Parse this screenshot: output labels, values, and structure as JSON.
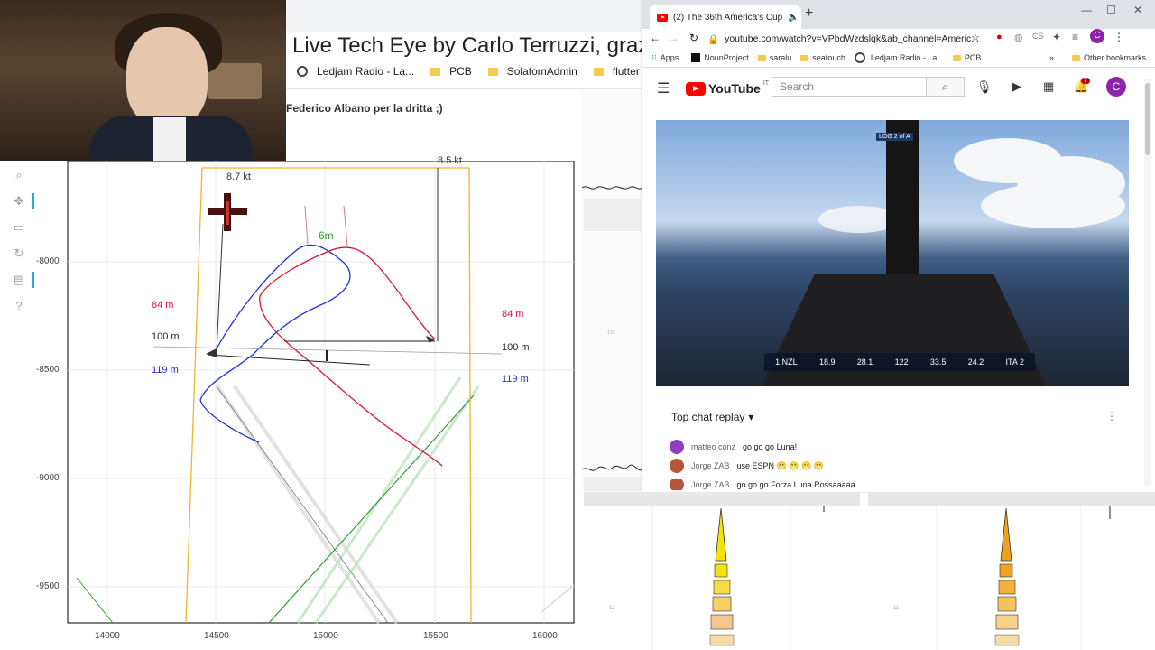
{
  "webcam": {
    "description_icon": "webcam-feed"
  },
  "background_browser": {
    "title": "Live Tech Eye by Carlo Terruzzi, graz",
    "bookmarks": [
      {
        "label": "Ledjam Radio - La..."
      },
      {
        "label": "PCB"
      },
      {
        "label": "SolatomAdmin"
      },
      {
        "label": "flutter"
      }
    ],
    "credit": "Federico Albano per la dritta ;)"
  },
  "plot": {
    "y_ticks": [
      "-8000",
      "-8500",
      "-9000",
      "-9500"
    ],
    "x_ticks": [
      "14000",
      "14500",
      "15000",
      "15500",
      "16000"
    ],
    "labels": {
      "speed_left": "8.7 kt",
      "speed_right": "8.5 kt",
      "gap": "6m",
      "left_84": "84 m",
      "left_100": "100 m",
      "left_119": "119 m",
      "right_84": "84 m",
      "right_100": "100 m",
      "right_119": "119 m"
    },
    "mini_labels": {
      "a": "10",
      "b": "12",
      "c": "11"
    }
  },
  "youtube_window": {
    "tab_title": "(2) The 36th America's Cup",
    "url": "youtube.com/watch?v=VPbdWzdslqk&ab_channel=Americ...",
    "bookmarks": [
      "Apps",
      "NounProject",
      "saralu",
      "seatouch",
      "Ledjam Radio - La...",
      "PCB"
    ],
    "other_bookmarks": "Other bookmarks",
    "search_placeholder": "Search",
    "notification_count": "7",
    "avatar_letter": "C",
    "logo_text": "YouTube",
    "logo_country": "IT",
    "scorebar": [
      "1 NZL",
      "18.9",
      "28.1",
      "122",
      "33.5",
      "24.2",
      "ITA 2"
    ],
    "video_badge": "LOG 2 of A",
    "chat_header": "Top chat replay",
    "chat": [
      {
        "author": "matteo conz",
        "text": "go go go Luna!",
        "color": "#8e3fbd"
      },
      {
        "author": "Jorge ZAB",
        "text": "use ESPN 😁 😁 😁 😁",
        "color": "#b5563a"
      },
      {
        "author": "Jorge ZAB",
        "text": "go go go Forza Luna Rossaaaaa",
        "color": "#b5563a"
      }
    ]
  },
  "colors": {
    "blue_track": "#1f2ee6",
    "red_track": "#e0123a",
    "green_line": "#2e9e2e",
    "orange_box": "#f0b331",
    "accent": "#26aae1"
  }
}
